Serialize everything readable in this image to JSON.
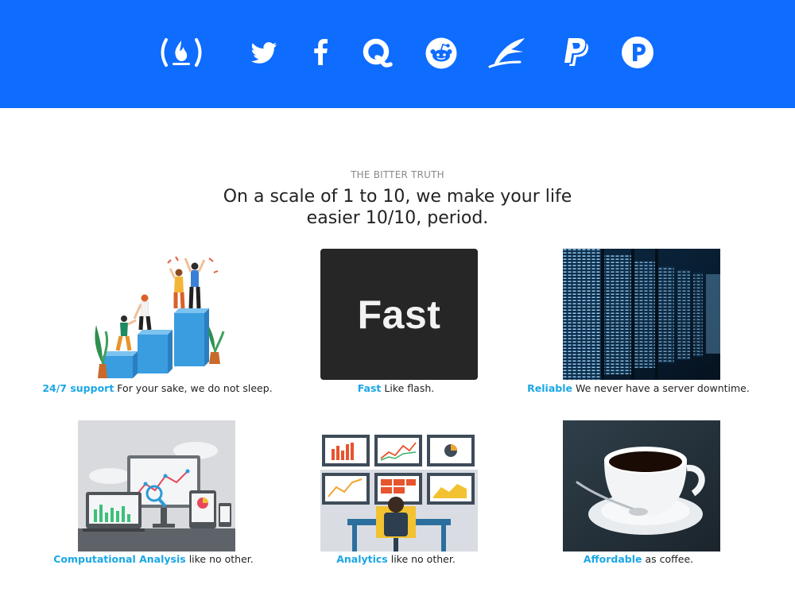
{
  "nav": {
    "icons": [
      "freecodecamp-icon",
      "twitter-icon",
      "facebook-icon",
      "quora-icon",
      "reddit-icon",
      "feather-icon",
      "paypal-icon",
      "patreon-icon"
    ]
  },
  "section": {
    "eyebrow": "THE BITTER TRUTH",
    "headline_line1": "On a scale of 1 to 10, we make your life",
    "headline_line2": "easier 10/10, period."
  },
  "features": [
    {
      "title": "24/7 support",
      "text": "For your sake, we do not sleep."
    },
    {
      "title": "Fast",
      "text": "Like flash.",
      "tile_text": "Fast"
    },
    {
      "title": "Reliable",
      "text": "We never have a server downtime."
    },
    {
      "title": "Computational Analysis",
      "text": "like no other."
    },
    {
      "title": "Analytics",
      "text": "like no other."
    },
    {
      "title": "Affordable",
      "text": "as coffee."
    }
  ],
  "colors": {
    "brand_blue": "#0e6cff",
    "highlight": "#1aa7e6"
  }
}
